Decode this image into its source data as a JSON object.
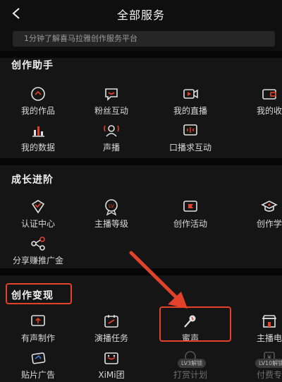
{
  "header": {
    "title": "全部服务"
  },
  "banner": {
    "text": "1分钟了解喜马拉雅创作服务平台"
  },
  "sections": {
    "assistant": {
      "title": "创作助手",
      "items": [
        "我的作品",
        "粉丝互动",
        "我的直播",
        "我的收",
        "我的数据",
        "声播",
        "口播求互动"
      ]
    },
    "growth": {
      "title": "成长进阶",
      "items": [
        "认证中心",
        "主播等级",
        "创作活动",
        "创作学",
        "分享赚推广金"
      ]
    },
    "monetize": {
      "title": "创作变现",
      "items": [
        "有声制作",
        "演播任务",
        "蜜声",
        "主播电",
        "贴片广告",
        "XiMi团",
        "打赏计划",
        "付费专"
      ],
      "badges": [
        "LV3解锁",
        "LV10解锁"
      ]
    }
  },
  "colors": {
    "accent": "#e2412a",
    "background": "#0f0f0f",
    "panel": "#151515"
  },
  "icons": [
    "back-icon",
    "music-disc-icon",
    "chat-heart-icon",
    "video-camera-icon",
    "wallet-icon",
    "bar-chart-icon",
    "voice-person-icon",
    "mic-screen-icon",
    "certificate-icon",
    "level-badge-icon",
    "flag-icon",
    "graduation-cap-icon",
    "share-icon",
    "upload-screen-icon",
    "calendar-task-icon",
    "microphone-icon",
    "shop-icon",
    "ad-card-icon",
    "group-icon",
    "tip-icon",
    "paid-icon"
  ]
}
